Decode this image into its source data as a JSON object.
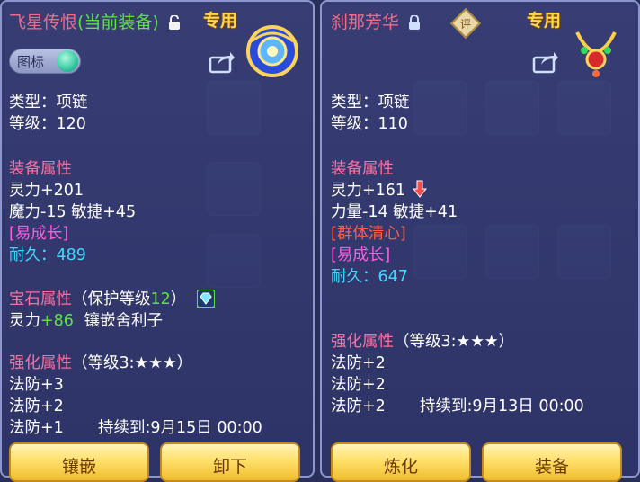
{
  "left": {
    "title": "飞星传恨",
    "title_suffix": "(当前装备)",
    "exclusive_label": "专用",
    "toggle_label": "图标",
    "type_line": "类型：项链",
    "level_line": "等级：120",
    "attr_header": "装备属性",
    "attr_1": "灵力+201",
    "attr_2": "魔力-15 敏捷+45",
    "special": "[易成长]",
    "durability_label": "耐久：",
    "durability_value": "489",
    "gem_header": "宝石属性",
    "gem_protect_prefix": "（保护等级",
    "gem_protect_level": "12",
    "gem_protect_suffix": "）",
    "gem_stat": "灵力",
    "gem_value": "+86",
    "gem_desc": "镶嵌舍利子",
    "enhance_header": "强化属性",
    "enhance_level": "（等级3:★★★）",
    "enhance_1": "法防+3",
    "enhance_2": "法防+2",
    "enhance_3": "法防+1",
    "enhance_duration": "持续到:9月15日 00:00",
    "btn_inlay": "镶嵌",
    "btn_unequip": "卸下"
  },
  "right": {
    "title": "刹那芳华",
    "rate_badge": "评",
    "exclusive_label": "专用",
    "type_line": "类型：项链",
    "level_line": "等级：110",
    "attr_header": "装备属性",
    "attr_1": "灵力+161",
    "attr_2": "力量-14 敏捷+41",
    "special_1": "[群体清心]",
    "special_2": "[易成长]",
    "durability_label": "耐久：",
    "durability_value": "647",
    "enhance_header": "强化属性",
    "enhance_level": "（等级3:★★★）",
    "enhance_1": "法防+2",
    "enhance_2": "法防+2",
    "enhance_3": "法防+2",
    "enhance_duration": "持续到:9月13日 00:00",
    "btn_refine": "炼化",
    "btn_equip": "装备"
  },
  "colors": {
    "title": "#f06a8a",
    "equipped": "#5fe04a",
    "exclusive": "#ffd84a",
    "header": "#ff6ea0",
    "special": "#ff5ce0",
    "group_special": "#ff5f4a",
    "durability": "#43d8ff",
    "button": "#ffe06a"
  },
  "icons": [
    "unlock-icon",
    "lock-icon",
    "share-icon",
    "gem-icon",
    "down-arrow-icon",
    "necklace-icon"
  ]
}
